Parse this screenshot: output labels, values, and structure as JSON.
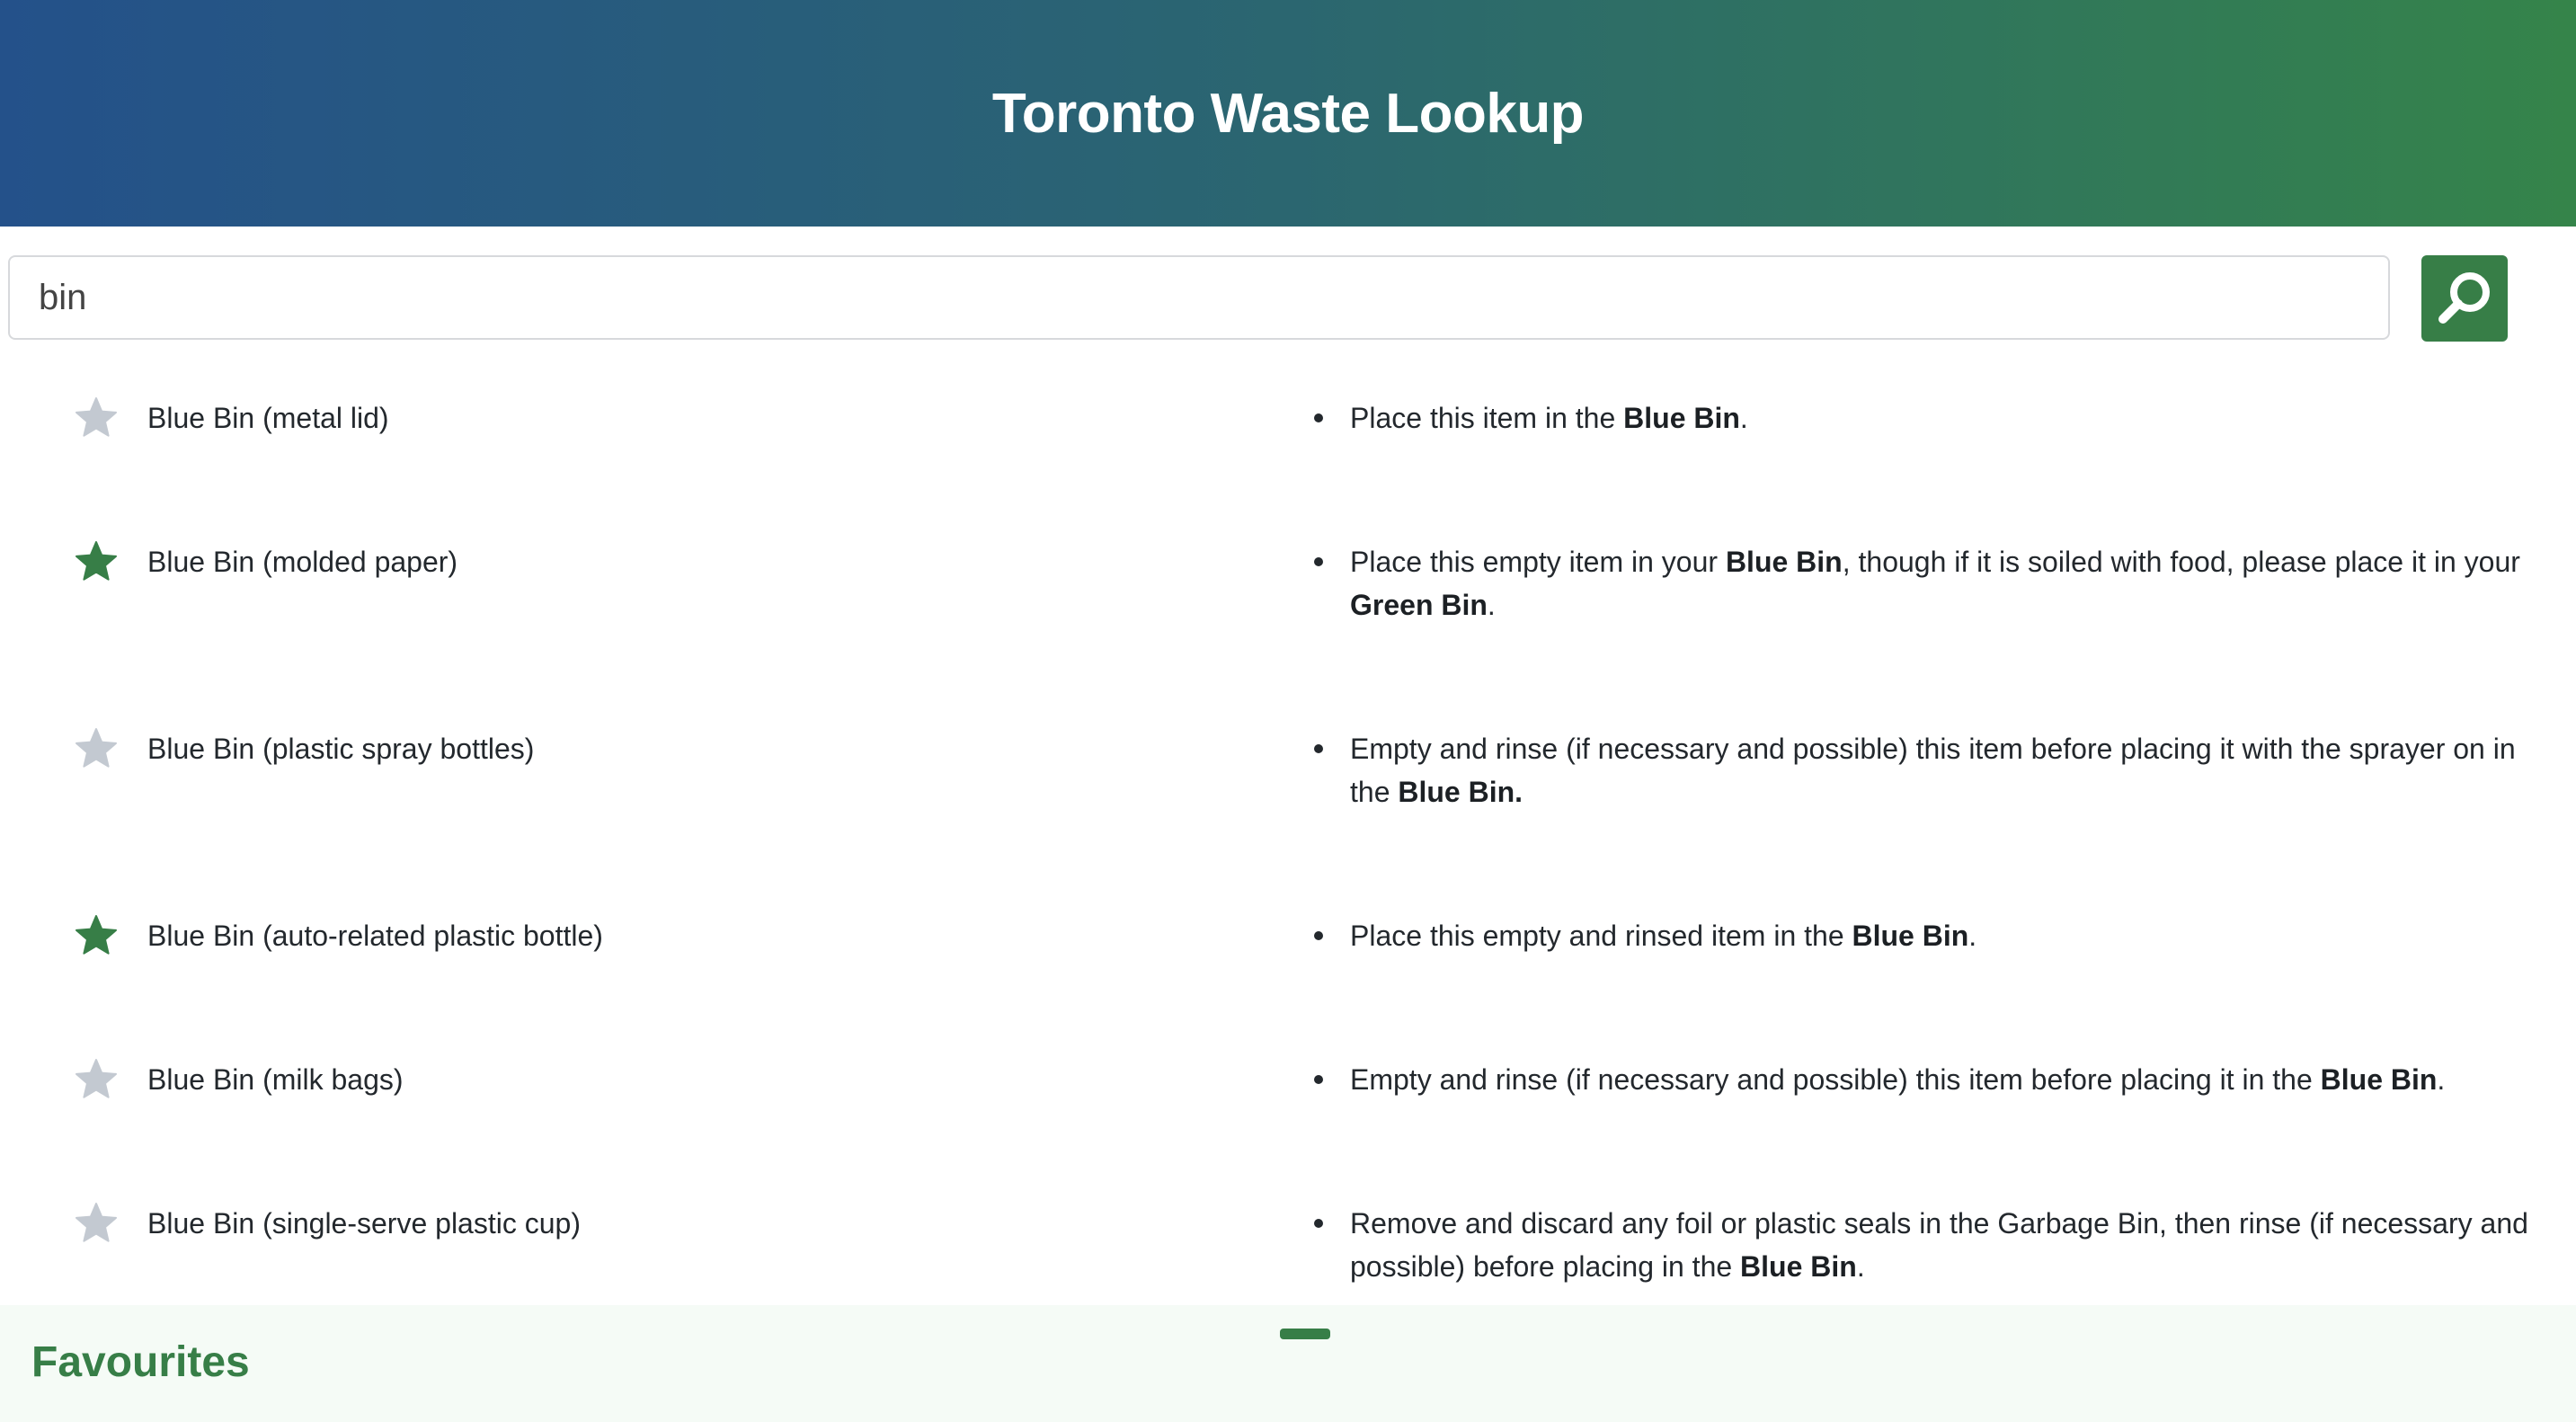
{
  "app": {
    "title": "Toronto Waste Lookup"
  },
  "search": {
    "value": "bin",
    "button_icon": "search-icon"
  },
  "colors": {
    "header_gradient_start": "#24518a",
    "header_gradient_end": "#35844a",
    "accent_green": "#377e47",
    "star_off": "#c3c9d1",
    "favourites_bg": "#f5fbf6"
  },
  "results": [
    {
      "name": "Blue Bin (metal lid)",
      "favourited": false,
      "instructions": [
        {
          "t": "Place this item in the "
        },
        {
          "t": "Blue Bin",
          "b": true
        },
        {
          "t": "."
        }
      ]
    },
    {
      "name": "Blue Bin (molded paper)",
      "favourited": true,
      "instructions": [
        {
          "t": "Place this empty item in your "
        },
        {
          "t": "Blue Bin",
          "b": true
        },
        {
          "t": ", though if it is soiled with food, please place it in your "
        },
        {
          "t": "Green Bin",
          "b": true
        },
        {
          "t": "."
        }
      ]
    },
    {
      "name": "Blue Bin (plastic spray bottles)",
      "favourited": false,
      "instructions": [
        {
          "t": "Empty and rinse (if necessary and possible) this item before placing it with the sprayer on in the "
        },
        {
          "t": "Blue Bin.",
          "b": true
        }
      ]
    },
    {
      "name": "Blue Bin (auto-related plastic bottle)",
      "favourited": true,
      "instructions": [
        {
          "t": "Place this empty and rinsed item in the "
        },
        {
          "t": "Blue Bin",
          "b": true
        },
        {
          "t": "."
        }
      ]
    },
    {
      "name": "Blue Bin (milk bags)",
      "favourited": false,
      "instructions": [
        {
          "t": "Empty and rinse (if necessary and possible) this item before placing it in the "
        },
        {
          "t": "Blue Bin",
          "b": true
        },
        {
          "t": "."
        }
      ]
    },
    {
      "name": "Blue Bin (single-serve plastic cup)",
      "favourited": false,
      "instructions": [
        {
          "t": "Remove and discard any foil or plastic seals in the Garbage Bin, then rinse (if necessary and possible) before placing in the "
        },
        {
          "t": "Blue Bin",
          "b": true
        },
        {
          "t": "."
        }
      ]
    }
  ],
  "favourites": {
    "title": "Favourites"
  }
}
